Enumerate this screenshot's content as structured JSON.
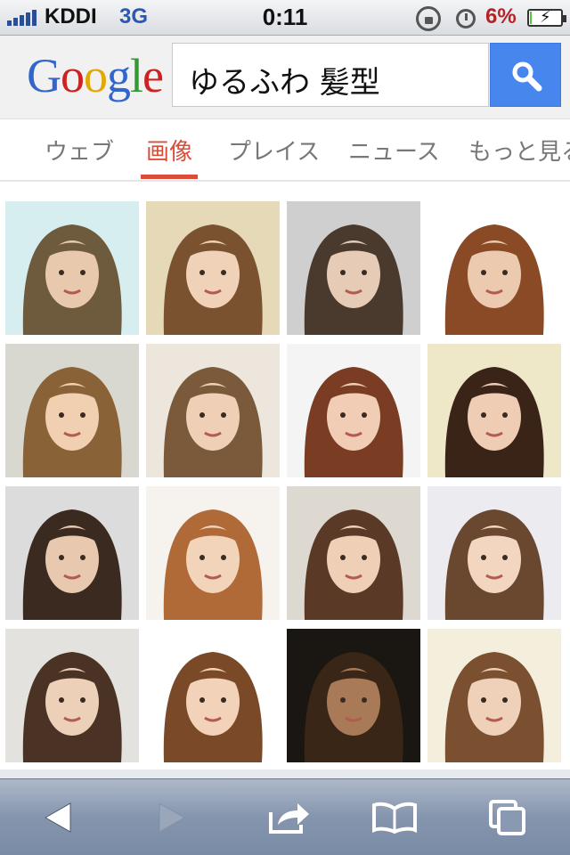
{
  "status_bar": {
    "carrier": "KDDI",
    "network": "3G",
    "time": "0:11",
    "battery_percent": "6%",
    "battery_level": 0.06,
    "icons": [
      "signal-icon",
      "orientation-lock-icon",
      "alarm-icon",
      "battery-charging-icon"
    ]
  },
  "header": {
    "logo_letters": [
      "G",
      "o",
      "o",
      "g",
      "l",
      "e"
    ],
    "search_value": "ゆるふわ 髪型",
    "search_button_icon": "magnifier-icon"
  },
  "tabs": [
    {
      "label": "ウェブ",
      "active": false
    },
    {
      "label": "画像",
      "active": true
    },
    {
      "label": "プレイス",
      "active": false
    },
    {
      "label": "ニュース",
      "active": false
    },
    {
      "label": "もっと見る",
      "active": false
    }
  ],
  "image_results": {
    "rows": 4,
    "columns": 4,
    "count": 16
  },
  "toolbar": {
    "icons": [
      "back-arrow-icon",
      "forward-arrow-icon",
      "share-icon",
      "bookmarks-icon",
      "pages-icon"
    ]
  },
  "colors": {
    "accent_red": "#dd4b39",
    "search_button": "#4787ed",
    "google_blue": "#3366cc",
    "google_red": "#cc2222",
    "google_yellow": "#e0a800",
    "google_green": "#339933"
  }
}
